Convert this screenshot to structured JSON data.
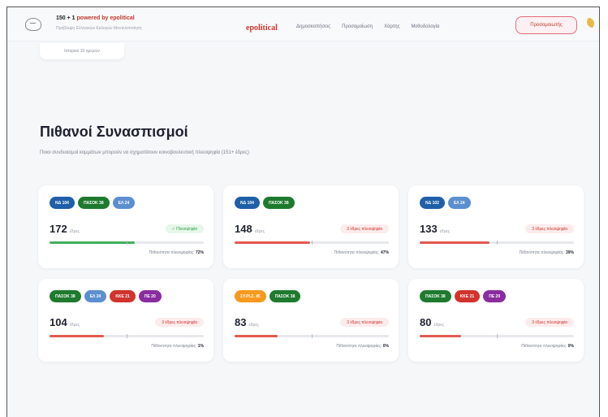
{
  "header": {
    "brand_title": "150 + 1",
    "brand_title_sub": "powered by epolitical",
    "brand_subtitle": "Πρόβλεψη Ελληνικών Εκλογών Μοντελοποίηση",
    "nav_brand": "epolitical",
    "nav": [
      "Δημοσκοπήσεις",
      "Προσομοίωση",
      "Χάρτης",
      "Μεθοδολογία"
    ],
    "cta": "Προσομοιωτής",
    "theme_icon": "moon-icon"
  },
  "top_pill": "Ιστορικό 10 ημερών",
  "section": {
    "title": "Πιθανοί Συνασπισμοί",
    "description": "Ποιοι συνδυασμοί κομμάτων μπορούν να σχηματίσουν κοινοβουλευτική πλειοψηφία (151+ έδρες)"
  },
  "colors": {
    "nd": "#1f5fa8",
    "pasok": "#1e7a2e",
    "el": "#5b8fd0",
    "kke": "#d0342c",
    "pe": "#8a2ca0",
    "syriza": "#f59a1e",
    "bar_green": "#43b05c",
    "bar_red": "#e05a50"
  },
  "seats_unit": "έδρες",
  "prob_label": "Πιθανότητα πλειοψηφίας:",
  "coalitions": [
    {
      "chips": [
        {
          "label": "ΝΔ 104",
          "color": "nd"
        },
        {
          "label": "ΠΑΣΟΚ 38",
          "color": "pasok"
        },
        {
          "label": "ΕΛ 24",
          "color": "el"
        }
      ],
      "seats": "172",
      "status": "✓ Πλειοψηφία",
      "majority": true,
      "fill": 0.55,
      "prob": "72%"
    },
    {
      "chips": [
        {
          "label": "ΝΔ 104",
          "color": "nd"
        },
        {
          "label": "ΠΑΣΟΚ 38",
          "color": "pasok"
        }
      ],
      "seats": "148",
      "status": "3 έδρες πλειοψηφία",
      "majority": false,
      "fill": 0.49,
      "prob": "47%"
    },
    {
      "chips": [
        {
          "label": "ΝΔ 102",
          "color": "nd"
        },
        {
          "label": "ΕΛ 24",
          "color": "el"
        }
      ],
      "seats": "133",
      "status": "3 έδρες πλειοψηφία",
      "majority": false,
      "fill": 0.45,
      "prob": "39%"
    },
    {
      "chips": [
        {
          "label": "ΠΑΣΟΚ 38",
          "color": "pasok"
        },
        {
          "label": "ΕΛ 24",
          "color": "el"
        },
        {
          "label": "ΚΚΕ 21",
          "color": "kke"
        },
        {
          "label": "ΠΕ 20",
          "color": "pe"
        }
      ],
      "seats": "104",
      "status": "3 έδρες πλειοψηφία",
      "majority": false,
      "fill": 0.35,
      "prob": "1%"
    },
    {
      "chips": [
        {
          "label": "ΣΥ.ΡΙ.Ζ. 45",
          "color": "syriza"
        },
        {
          "label": "ΠΑΣΟΚ 38",
          "color": "pasok"
        }
      ],
      "seats": "83",
      "status": "3 έδρες πλειοψηφία",
      "majority": false,
      "fill": 0.28,
      "prob": "0%"
    },
    {
      "chips": [
        {
          "label": "ΠΑΣΟΚ 38",
          "color": "pasok"
        },
        {
          "label": "ΚΚΕ 21",
          "color": "kke"
        },
        {
          "label": "ΠΕ 20",
          "color": "pe"
        }
      ],
      "seats": "80",
      "status": "3 έδρες πλειοψηφία",
      "majority": false,
      "fill": 0.27,
      "prob": "0%"
    }
  ]
}
